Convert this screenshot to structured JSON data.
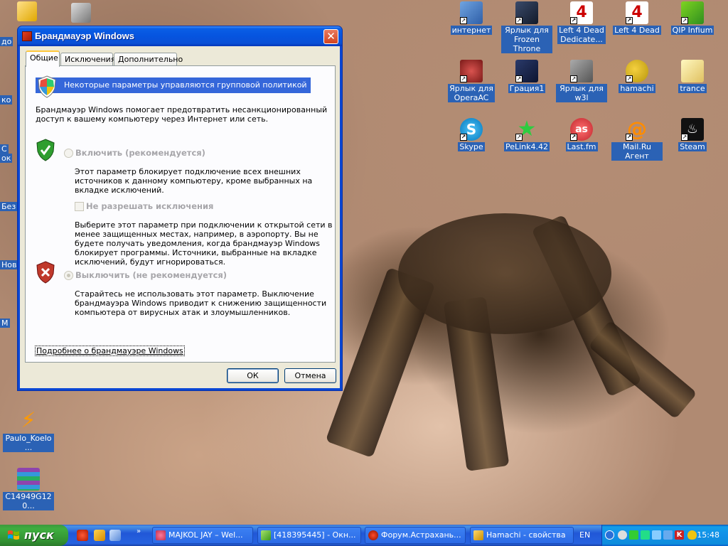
{
  "window": {
    "title": "Брандмауэр Windows",
    "tabs": [
      "Общие",
      "Исключения",
      "Дополнительно"
    ],
    "group_policy_notice": "Некоторые параметры управляются групповой политикой",
    "intro_line1": "Брандмауэр Windows помогает предотвратить несанкционированный",
    "intro_line2": "доступ к вашему компьютеру через Интернет или сеть.",
    "enable_option": "Включить (рекомендуется)",
    "enable_desc_line1": "Этот параметр блокирует подключение всех внешних",
    "enable_desc_line2": "источников к данному компьютеру, кроме выбранных на",
    "enable_desc_line3": "вкладке исключений.",
    "no_exceptions_label": "Не разрешать исключения",
    "no_exc_desc_line1": "Выберите этот параметр при подключении к открытой сети в",
    "no_exc_desc_line2": "менее защищенных местах, например, в аэропорту. Вы не",
    "no_exc_desc_line3": "будете получать уведомления, когда брандмауэр Windows",
    "no_exc_desc_line4": "блокирует программы. Источники, выбранные на вкладке",
    "no_exc_desc_line5": "исключений, будут игнорироваться.",
    "disable_option": "Выключить (не рекомендуется)",
    "disable_desc_line1": "Старайтесь не использовать этот параметр. Выключение",
    "disable_desc_line2": "брандмауэра Windows приводит к снижению защищенности",
    "disable_desc_line3": "компьютера от вирусных атак и злоумышленников.",
    "more_link": "Подробнее о брандмауэре Windows",
    "ok_label": "ОК",
    "cancel_label": "Отмена"
  },
  "desktop_icons": [
    {
      "line1": "интернет",
      "line2": ""
    },
    {
      "line1": "Ярлык для",
      "line2": "Frozen Throne"
    },
    {
      "line1": "Left 4 Dead",
      "line2": "Dedicate..."
    },
    {
      "line1": "Left 4 Dead",
      "line2": ""
    },
    {
      "line1": "QIP Infium",
      "line2": ""
    },
    {
      "line1": "Ярлык для",
      "line2": "OperaAC"
    },
    {
      "line1": "Грация1",
      "line2": ""
    },
    {
      "line1": "Ярлык для w3l",
      "line2": ""
    },
    {
      "line1": "hamachi",
      "line2": ""
    },
    {
      "line1": "trance",
      "line2": ""
    },
    {
      "line1": "Skype",
      "line2": ""
    },
    {
      "line1": "PeLink4.42",
      "line2": ""
    },
    {
      "line1": "Last.fm",
      "line2": ""
    },
    {
      "line1": "Mail.Ru Агент",
      "line2": ""
    },
    {
      "line1": "Steam",
      "line2": ""
    }
  ],
  "left_icons": {
    "winamp": "Paulo_Koelo...",
    "rar": "C14949G120..."
  },
  "left_partial_labels": [
    "до",
    "ко",
    "С",
    "ок",
    "Без",
    "Нов",
    "М"
  ],
  "taskbar": {
    "start_label": "пуск",
    "buttons": [
      "MAJKOL JAY – Wel...",
      "[418395445] - Окн...",
      "Форум.Астрахань...",
      "Hamachi - свойства"
    ],
    "lang": "EN",
    "clock": "15:48"
  },
  "colors": {
    "selection_blue": "#2b62b5",
    "xp_title_blue": "#0654df",
    "group_policy_bar": "#3567da",
    "start_green": "#3fae3f"
  }
}
